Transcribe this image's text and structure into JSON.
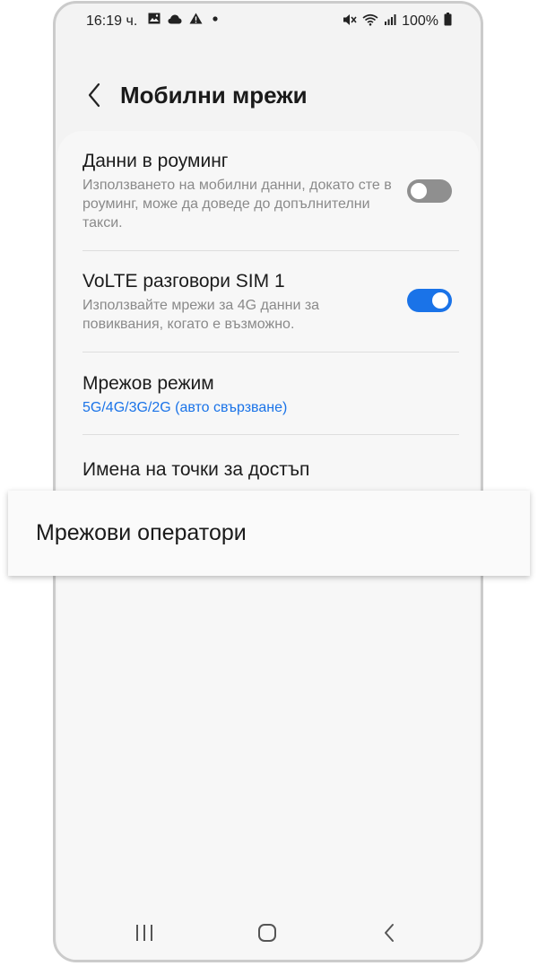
{
  "status_bar": {
    "time": "16:19 ч.",
    "battery": "100%",
    "left_icons": [
      "gallery-icon",
      "cloud-icon",
      "warning-icon",
      "dot-icon"
    ],
    "right_icons": [
      "mute-icon",
      "wifi-icon",
      "signal-icon",
      "battery-icon"
    ]
  },
  "header": {
    "title": "Мобилни мрежи"
  },
  "settings": {
    "roaming": {
      "title": "Данни в роуминг",
      "subtitle": "Използването на мобилни данни, докато сте в роуминг, може да доведе до допълнителни такси.",
      "toggle_on": false
    },
    "volte": {
      "title": "VoLTE разговори SIM 1",
      "subtitle": "Използвайте мрежи за 4G данни за повиквания, когато е възможно.",
      "toggle_on": true
    },
    "network_mode": {
      "title": "Мрежов режим",
      "value": "5G/4G/3G/2G (авто свързване)"
    },
    "apn": {
      "title": "Имена на точки за достъп"
    },
    "operators": {
      "title": "Мрежови оператори"
    }
  },
  "colors": {
    "accent": "#1a73e8",
    "toggle_off": "#8f8f8f",
    "background": "#f3f3f3"
  },
  "navbar": {
    "buttons": [
      "recent-apps-icon",
      "home-icon",
      "back-icon"
    ]
  }
}
